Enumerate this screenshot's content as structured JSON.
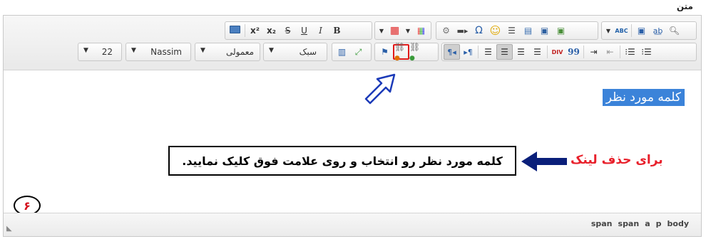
{
  "field_label": "متن",
  "toolbar": {
    "superscript_label": "x²",
    "subscript_label": "x₂",
    "strike_label": "S",
    "underline_label": "U",
    "italic_label": "I",
    "bold_label": "B",
    "omega_label": "Ω",
    "smiley_label": "☺",
    "spellcheck_label": "ABC",
    "size_value": "22",
    "font_value": "Nassim",
    "format_value": "معمولی",
    "style_value": "سبک",
    "quote_label": "99",
    "div_label": "DIV"
  },
  "content": {
    "selected_word": "کلمه مورد نظر",
    "instruction": "کلمه مورد نظر رو انتخاب و روی علامت فوق کلیک نمایید.",
    "note": "برای حذف لینک",
    "step_number": "۶"
  },
  "status": {
    "path": [
      "body",
      "p",
      "a",
      "span",
      "span"
    ]
  },
  "colors": {
    "selection": "#3b83d9",
    "highlight_red": "#e01a1a",
    "arrow_blue": "#1b3ab8",
    "note_red": "#e8202b"
  }
}
